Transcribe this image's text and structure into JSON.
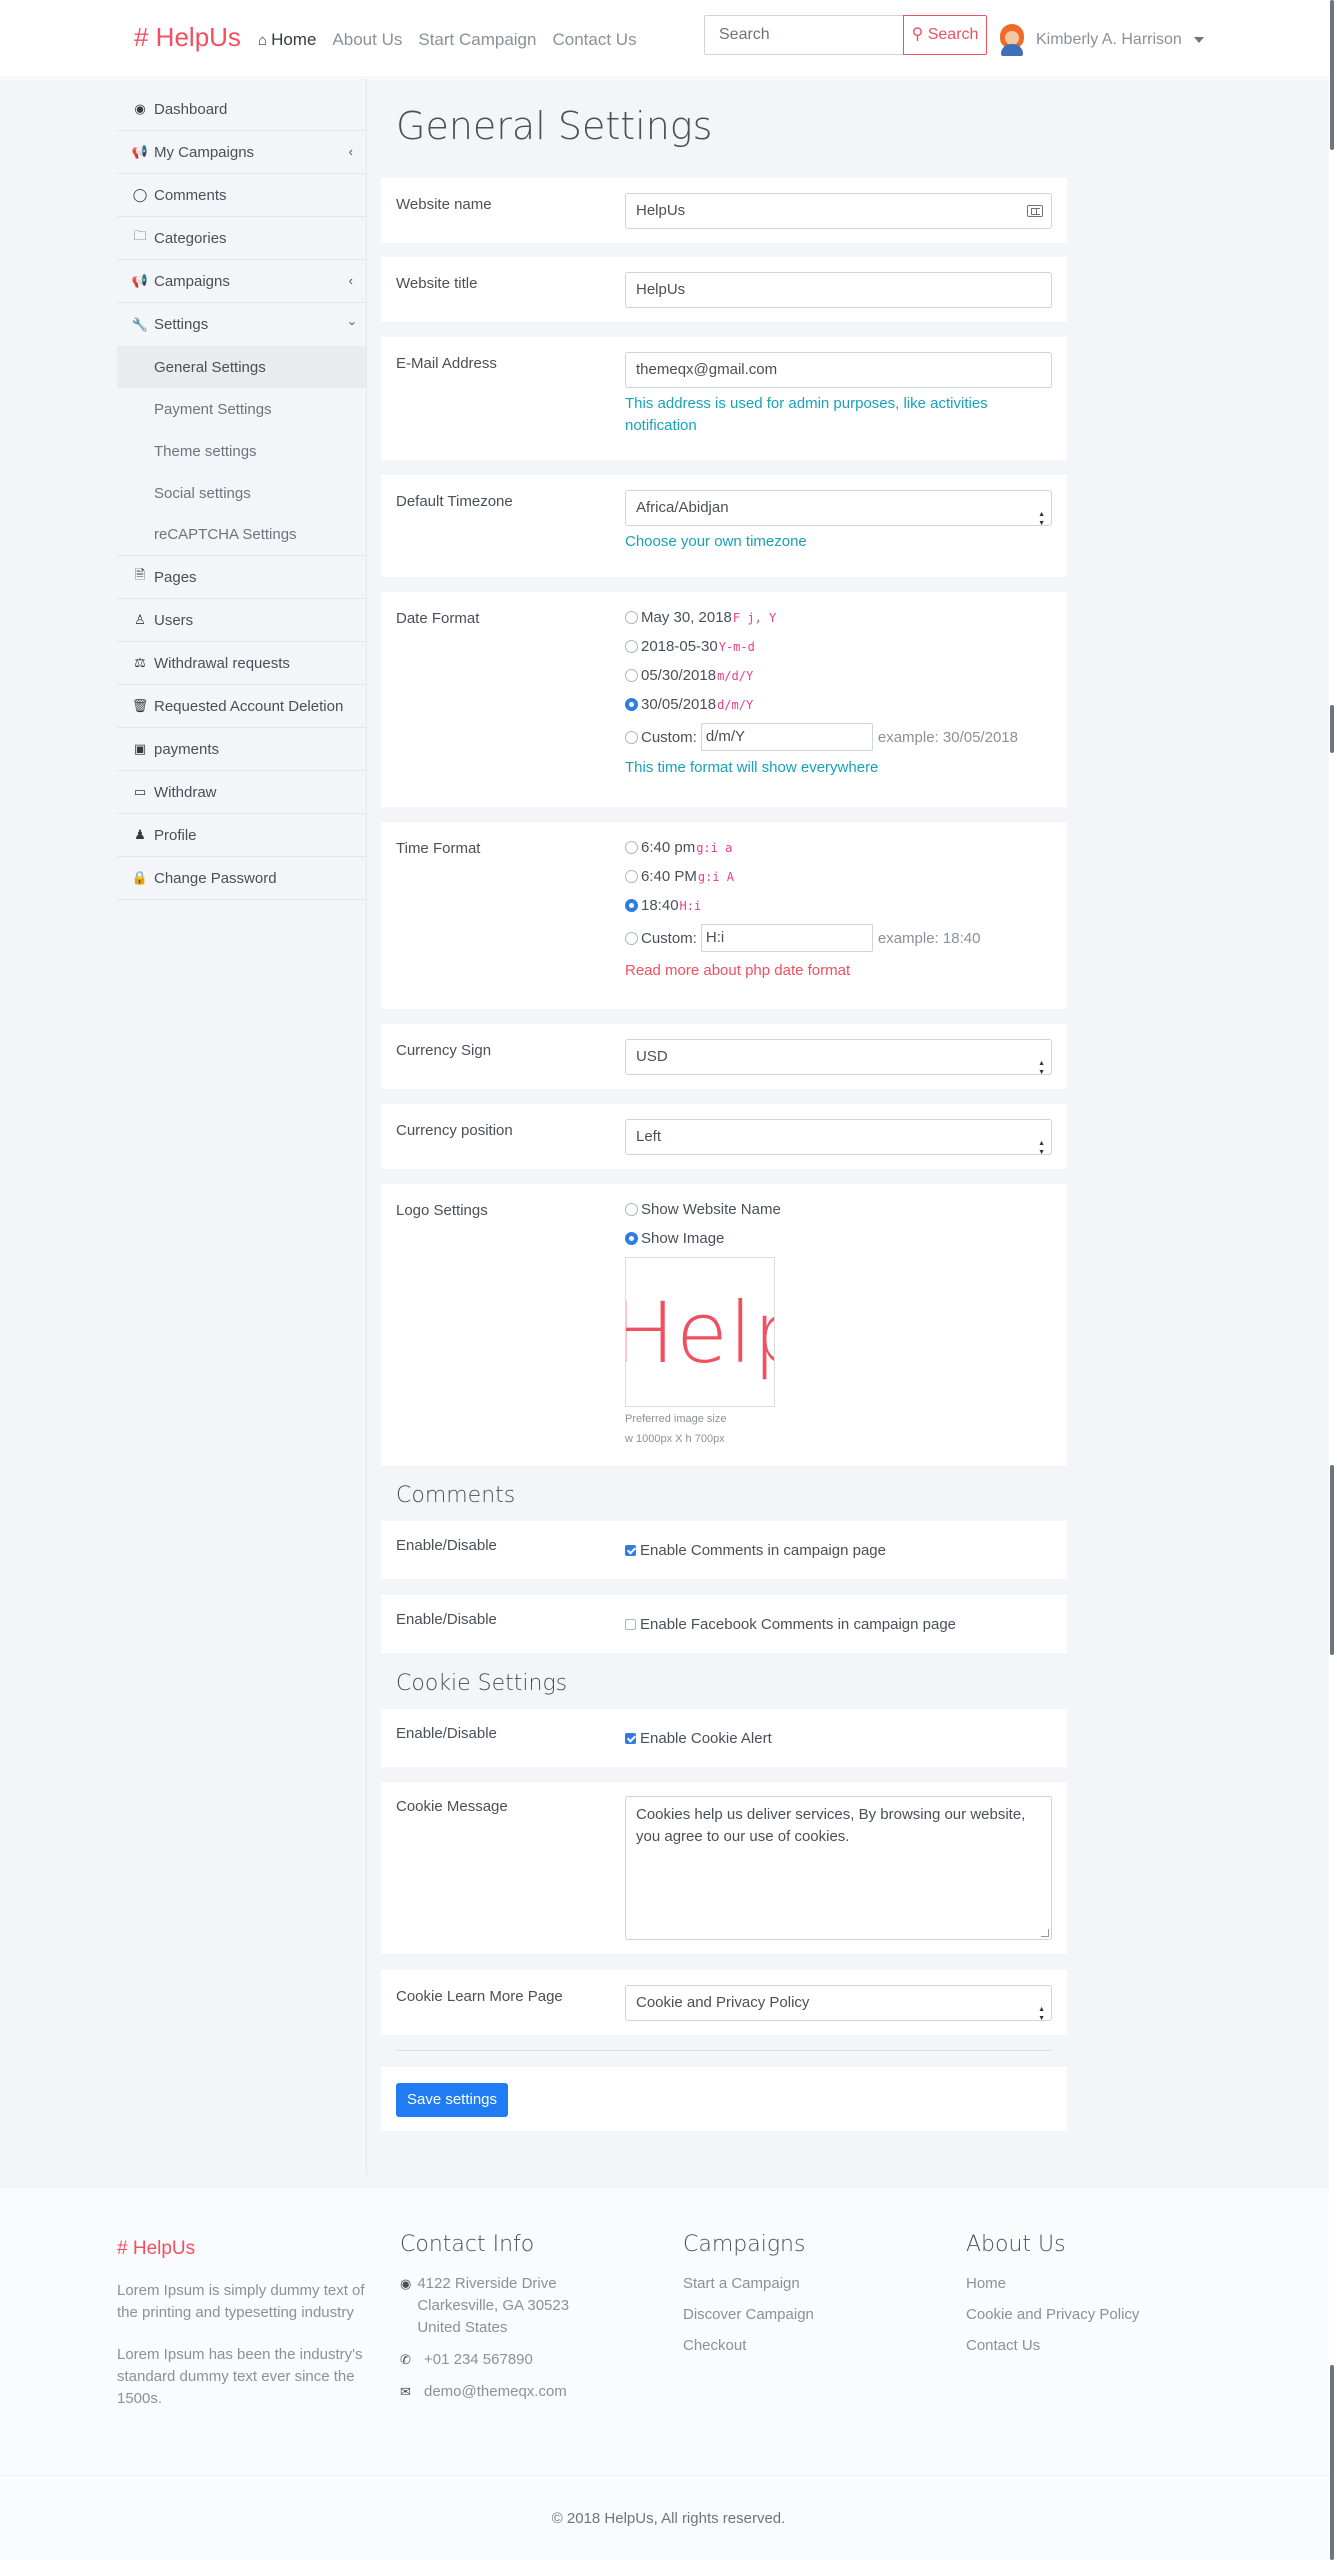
{
  "header": {
    "brand": "# HelpUs",
    "nav": [
      "Home",
      "About Us",
      "Start Campaign",
      "Contact Us"
    ],
    "search_placeholder": "Search",
    "search_button": "Search",
    "user_name": "Kimberly A. Harrison"
  },
  "sidebar": {
    "items": [
      {
        "label": "Dashboard",
        "icon": "dashboard-icon"
      },
      {
        "label": "My Campaigns",
        "icon": "bullhorn-icon"
      },
      {
        "label": "Comments",
        "icon": "comment-icon"
      },
      {
        "label": "Categories",
        "icon": "folder-icon"
      },
      {
        "label": "Campaigns",
        "icon": "bullhorn-icon"
      },
      {
        "label": "Settings",
        "icon": "wrench-icon"
      }
    ],
    "settings_sub": [
      "General Settings",
      "Payment Settings",
      "Theme settings",
      "Social settings",
      "reCAPTCHA Settings"
    ],
    "items_after": [
      {
        "label": "Pages",
        "icon": "file-icon"
      },
      {
        "label": "Users",
        "icon": "users-icon"
      },
      {
        "label": "Withdrawal requests",
        "icon": "balance-icon"
      },
      {
        "label": "Requested Account Deletion",
        "icon": "trash-icon"
      },
      {
        "label": "payments",
        "icon": "money-icon"
      },
      {
        "label": "Withdraw",
        "icon": "credit-card-icon"
      },
      {
        "label": "Profile",
        "icon": "user-icon"
      },
      {
        "label": "Change Password",
        "icon": "lock-icon"
      }
    ]
  },
  "main": {
    "title": "General Settings",
    "website_name": {
      "label": "Website name",
      "value": "HelpUs"
    },
    "website_title": {
      "label": "Website title",
      "value": "HelpUs"
    },
    "email": {
      "label": "E-Mail Address",
      "value": "themeqx@gmail.com",
      "help": "This address is used for admin purposes, like activities notification"
    },
    "timezone": {
      "label": "Default Timezone",
      "value": "Africa/Abidjan",
      "help": "Choose your own timezone"
    },
    "date_format": {
      "label": "Date Format",
      "options": [
        {
          "text": "May 30, 2018",
          "code": "F j, Y",
          "checked": false
        },
        {
          "text": "2018-05-30",
          "code": "Y-m-d",
          "checked": false
        },
        {
          "text": "05/30/2018",
          "code": "m/d/Y",
          "checked": false
        },
        {
          "text": "30/05/2018",
          "code": "d/m/Y",
          "checked": true
        }
      ],
      "custom_label": "Custom:",
      "custom_value": "d/m/Y",
      "example": "example: 30/05/2018",
      "help": "This time format will show everywhere"
    },
    "time_format": {
      "label": "Time Format",
      "options": [
        {
          "text": "6:40 pm",
          "code": "g:i a",
          "checked": false
        },
        {
          "text": "6:40 PM",
          "code": "g:i A",
          "checked": false
        },
        {
          "text": "18:40",
          "code": "H:i",
          "checked": true
        }
      ],
      "custom_label": "Custom:",
      "custom_value": "H:i",
      "example": "example: 18:40",
      "help": "Read more about php date format"
    },
    "currency_sign": {
      "label": "Currency Sign",
      "value": "USD"
    },
    "currency_position": {
      "label": "Currency position",
      "value": "Left"
    },
    "logo": {
      "label": "Logo Settings",
      "opt1": "Show Website Name",
      "opt2": "Show Image",
      "logo_text": "Help",
      "pref1": "Preferred image size",
      "pref2": "w 1000px X h 700px"
    },
    "comments": {
      "heading": "Comments",
      "row1_label": "Enable/Disable",
      "row1_text": "Enable Comments in campaign page",
      "row2_label": "Enable/Disable",
      "row2_text": "Enable Facebook Comments in campaign page"
    },
    "cookie": {
      "heading": "Cookie Settings",
      "enable_label": "Enable/Disable",
      "enable_text": "Enable Cookie Alert",
      "message_label": "Cookie Message",
      "message": "Cookies help us deliver services, By browsing our website, you agree to our use of cookies.",
      "page_label": "Cookie Learn More Page",
      "page_value": "Cookie and Privacy Policy"
    },
    "save_label": "Save settings"
  },
  "footer": {
    "brand": "# HelpUs",
    "text1": "Lorem Ipsum is simply dummy text of the printing and typesetting industry",
    "text2": "Lorem Ipsum has been the industry's standard dummy text ever since the 1500s.",
    "contact_heading": "Contact Info",
    "address": "4122 Riverside Drive Clarkesville, GA 30523 United States",
    "phone": "+01 234 567890",
    "email": "demo@themeqx.com",
    "campaigns_heading": "Campaigns",
    "campaign_links": [
      "Start a Campaign",
      "Discover Campaign",
      "Checkout"
    ],
    "about_heading": "About Us",
    "about_links": [
      "Home",
      "Cookie and Privacy Policy",
      "Contact Us"
    ],
    "copyright": "© 2018 HelpUs, All rights reserved."
  },
  "colors": {
    "brand": "#f0505f",
    "primary": "#1f7cf3",
    "help": "#17a2b8"
  }
}
